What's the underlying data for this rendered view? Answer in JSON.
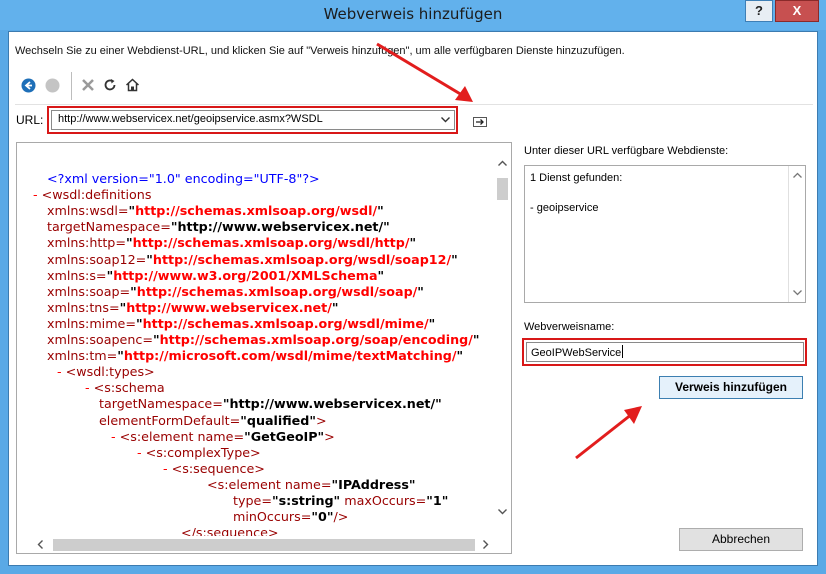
{
  "window": {
    "title": "Webverweis hinzufügen",
    "help_button": "?",
    "close_button": "X"
  },
  "instruction": "Wechseln Sie zu einer Webdienst-URL, und klicken Sie auf \"Verweis hinzufügen\", um alle verfügbaren Dienste hinzuzufügen.",
  "toolbar": {
    "items": [
      "back-icon",
      "forward-icon",
      "stop-icon",
      "refresh-icon",
      "home-icon"
    ]
  },
  "url": {
    "label": "URL:",
    "value": "http://www.webservicex.net/geoipservice.asmx?WSDL"
  },
  "document": {
    "lines": [
      [
        {
          "c": "bl",
          "t": "<?xml version=\"1.0\" encoding=\"UTF-8\"?>"
        }
      ],
      [
        {
          "c": "mn",
          "t": "- "
        },
        {
          "c": "rd",
          "t": "<wsdl:definitions"
        }
      ],
      [
        {
          "c": "rd",
          "t": "xmlns:wsdl="
        },
        {
          "c": "bk",
          "t": "\""
        },
        {
          "c": "rb",
          "t": "http://schemas.xmlsoap.org/wsdl/"
        },
        {
          "c": "bk",
          "t": "\""
        }
      ],
      [
        {
          "c": "rd",
          "t": "targetNamespace="
        },
        {
          "c": "bk",
          "t": "\"http://www.webservicex.net/\""
        }
      ],
      [
        {
          "c": "rd",
          "t": "xmlns:http="
        },
        {
          "c": "bk",
          "t": "\""
        },
        {
          "c": "rb",
          "t": "http://schemas.xmlsoap.org/wsdl/http/"
        },
        {
          "c": "bk",
          "t": "\""
        }
      ],
      [
        {
          "c": "rd",
          "t": "xmlns:soap12="
        },
        {
          "c": "bk",
          "t": "\""
        },
        {
          "c": "rb",
          "t": "http://schemas.xmlsoap.org/wsdl/soap12/"
        },
        {
          "c": "bk",
          "t": "\""
        }
      ],
      [
        {
          "c": "rd",
          "t": "xmlns:s="
        },
        {
          "c": "bk",
          "t": "\""
        },
        {
          "c": "rb",
          "t": "http://www.w3.org/2001/XMLSchema"
        },
        {
          "c": "bk",
          "t": "\""
        }
      ],
      [
        {
          "c": "rd",
          "t": "xmlns:soap="
        },
        {
          "c": "bk",
          "t": "\""
        },
        {
          "c": "rb",
          "t": "http://schemas.xmlsoap.org/wsdl/soap/"
        },
        {
          "c": "bk",
          "t": "\""
        }
      ],
      [
        {
          "c": "rd",
          "t": "xmlns:tns="
        },
        {
          "c": "bk",
          "t": "\""
        },
        {
          "c": "rb",
          "t": "http://www.webservicex.net/"
        },
        {
          "c": "bk",
          "t": "\""
        }
      ],
      [
        {
          "c": "rd",
          "t": "xmlns:mime="
        },
        {
          "c": "bk",
          "t": "\""
        },
        {
          "c": "rb",
          "t": "http://schemas.xmlsoap.org/wsdl/mime/"
        },
        {
          "c": "bk",
          "t": "\""
        }
      ],
      [
        {
          "c": "rd",
          "t": "xmlns:soapenc="
        },
        {
          "c": "bk",
          "t": "\""
        },
        {
          "c": "rb",
          "t": "http://schemas.xmlsoap.org/soap/encoding/"
        },
        {
          "c": "bk",
          "t": "\""
        }
      ],
      [
        {
          "c": "rd",
          "t": "xmlns:tm="
        },
        {
          "c": "bk",
          "t": "\""
        },
        {
          "c": "rb",
          "t": "http://microsoft.com/wsdl/mime/textMatching/"
        },
        {
          "c": "bk",
          "t": "\""
        }
      ],
      [
        {
          "c": "mn",
          "t": "- "
        },
        {
          "c": "rd",
          "t": "<wsdl:types>"
        }
      ],
      [
        {
          "c": "mn",
          "t": "- "
        },
        {
          "c": "rd",
          "t": "<s:schema"
        }
      ],
      [
        {
          "c": "rd",
          "t": "targetNamespace="
        },
        {
          "c": "bk",
          "t": "\"http://www.webservicex.net/\""
        }
      ],
      [
        {
          "c": "rd",
          "t": "elementFormDefault="
        },
        {
          "c": "bk",
          "t": "\"qualified\""
        },
        {
          "c": "rd",
          "t": ">"
        }
      ],
      [
        {
          "c": "mn",
          "t": "- "
        },
        {
          "c": "rd",
          "t": "<s:element name="
        },
        {
          "c": "bk",
          "t": "\"GetGeoIP\""
        },
        {
          "c": "rd",
          "t": ">"
        }
      ],
      [
        {
          "c": "mn",
          "t": "- "
        },
        {
          "c": "rd",
          "t": "<s:complexType>"
        }
      ],
      [
        {
          "c": "mn",
          "t": "- "
        },
        {
          "c": "rd",
          "t": "<s:sequence>"
        }
      ],
      [
        {
          "c": "rd",
          "t": "<s:element name="
        },
        {
          "c": "bk",
          "t": "\"IPAddress\""
        }
      ],
      [
        {
          "c": "rd",
          "t": "type="
        },
        {
          "c": "bk",
          "t": "\"s:string\""
        },
        {
          "c": "rd",
          "t": " maxOccurs="
        },
        {
          "c": "bk",
          "t": "\"1\""
        }
      ],
      [
        {
          "c": "rd",
          "t": "minOccurs="
        },
        {
          "c": "bk",
          "t": "\"0\""
        },
        {
          "c": "rd",
          "t": "/>"
        }
      ],
      [
        {
          "c": "rd",
          "t": "</s:sequence>"
        }
      ]
    ]
  },
  "services": {
    "label": "Unter dieser URL verfügbare Webdienste:",
    "found": "1 Dienst gefunden:",
    "items": [
      "- geoipservice"
    ]
  },
  "reference": {
    "label": "Webverweisname:",
    "value": "GeoIPWebService"
  },
  "buttons": {
    "add": "Verweis hinzufügen",
    "cancel": "Abbrechen"
  },
  "colors": {
    "annotation_red": "#d81818",
    "title_blue": "#62b1ec"
  }
}
